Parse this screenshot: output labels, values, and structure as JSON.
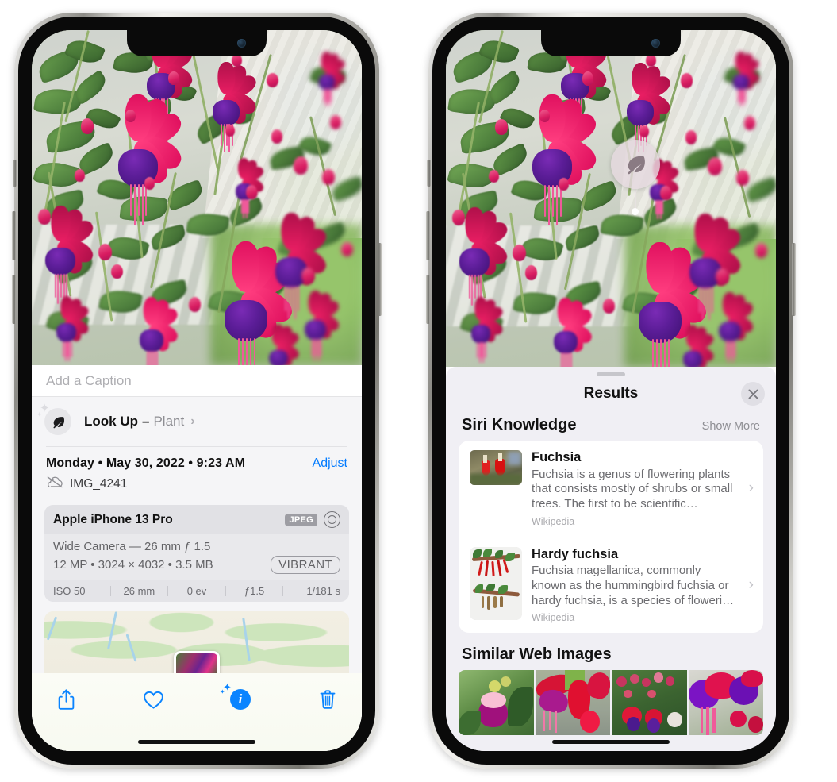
{
  "left_phone": {
    "name": "iphone-photos-info",
    "caption": {
      "placeholder": "Add a Caption",
      "value": ""
    },
    "look_up": {
      "icon": "leaf-icon",
      "label": "Look Up",
      "dash": "–",
      "subject": "Plant",
      "chevron": "›"
    },
    "metadata": {
      "date_line": "Monday • May 30, 2022 • 9:23 AM",
      "adjust_label": "Adjust",
      "cloud_icon": "cloud-slash-icon",
      "filename": "IMG_4241"
    },
    "camera_card": {
      "device": "Apple iPhone 13 Pro",
      "format_badge": "JPEG",
      "lens_icon": "lens-icon",
      "lens_line": "Wide Camera — 26 mm ƒ 1.5",
      "size_line": "12 MP • 3024 × 4032 • 3.5 MB",
      "style_badge": "VIBRANT",
      "exif": [
        "ISO 50",
        "26 mm",
        "0 ev",
        "ƒ1.5",
        "1/181 s"
      ]
    },
    "map": {
      "pin_label": "photo-thumbnail-pin"
    },
    "toolbar": [
      {
        "name": "share-button",
        "icon": "share-icon"
      },
      {
        "name": "favorite-button",
        "icon": "heart-icon"
      },
      {
        "name": "info-button",
        "icon": "info-sparkle-icon"
      },
      {
        "name": "delete-button",
        "icon": "trash-icon"
      }
    ]
  },
  "right_phone": {
    "name": "iphone-visual-lookup-results",
    "badge": {
      "icon": "leaf-icon",
      "name": "visual-look-up-badge"
    },
    "sheet": {
      "title": "Results",
      "close_label": "×",
      "grabber": "drag-handle"
    },
    "siri_knowledge": {
      "header": "Siri Knowledge",
      "show_more": "Show More",
      "items": [
        {
          "title": "Fuchsia",
          "description": "Fuchsia is a genus of flowering plants that consists mostly of shrubs or small trees. The first to be scientific…",
          "source": "Wikipedia",
          "chevron": "›"
        },
        {
          "title": "Hardy fuchsia",
          "description": "Fuchsia magellanica, commonly known as the hummingbird fuchsia or hardy fuchsia, is a species of floweri…",
          "source": "Wikipedia",
          "chevron": "›"
        }
      ]
    },
    "similar_web_images": {
      "header": "Similar Web Images",
      "thumbnails": [
        "fuchsia-magenta-white-bloom",
        "fuchsia-red-closeup",
        "fuchsia-shrub-buds",
        "fuchsia-purple-red-double"
      ]
    }
  },
  "colors": {
    "accent_blue": "#007aff",
    "sheet_bg": "#f0eff4",
    "panel_bg": "#f5f5f7",
    "card_bg": "#e9e9ec",
    "muted_text": "#8e8e93"
  }
}
